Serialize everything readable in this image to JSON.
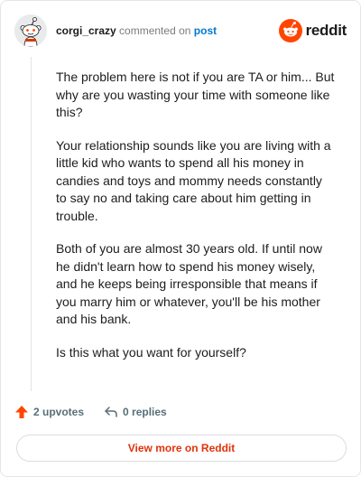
{
  "header": {
    "username": "corgi_crazy",
    "commented_text": "commented on",
    "post_link": "post",
    "logo_text": "reddit"
  },
  "comment": {
    "paragraphs": [
      "The problem here is not if you are TA or him... But why are you wasting your time with someone like this?",
      "Your relationship sounds like you are living with a little kid who wants to spend all his money in candies and toys and mommy needs constantly to say no and taking care about him getting in trouble.",
      "Both of you are almost 30 years old. If until now he didn't learn how to spend his money wisely, and he keeps being irresponsible that means if you marry him or whatever, you'll be his mother and his bank.",
      "Is this what you want for yourself?"
    ]
  },
  "actions": {
    "upvotes": "2 upvotes",
    "replies": "0 replies"
  },
  "footer": {
    "view_more": "View more on Reddit"
  },
  "colors": {
    "brand": "#ff4500",
    "link": "#0079d3",
    "view_more": "#e0330a",
    "muted": "#576f76"
  },
  "icons": {
    "avatar": "snoo-avatar-icon",
    "logo": "reddit-snoo-icon",
    "upvote": "upvote-arrow-icon",
    "reply": "reply-arrow-icon"
  }
}
